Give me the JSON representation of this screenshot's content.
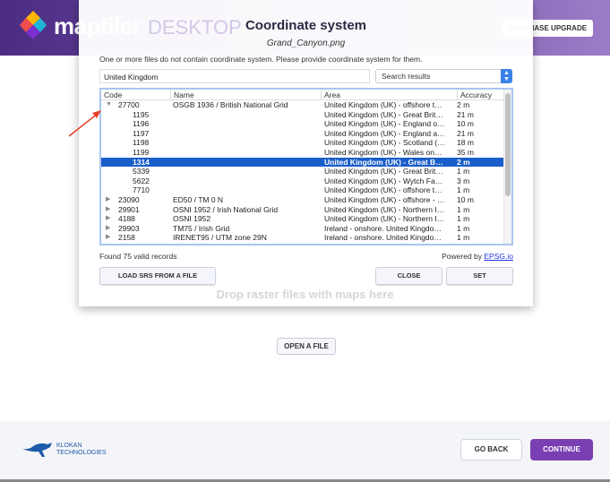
{
  "app": {
    "brand": "maptiler",
    "edition": "DESKTOP",
    "purchase_label": "PURCHASE UPGRADE",
    "drop_hint": "Drop raster files with maps here",
    "open_file_label": "OPEN A FILE"
  },
  "footer": {
    "company_line1": "KLOKAN",
    "company_line2": "TECHNOLOGIES",
    "go_back_label": "GO BACK",
    "continue_label": "CONTINUE",
    "accent": "#7a3fb2"
  },
  "dialog": {
    "title": "Coordinate system",
    "file": "Grand_Canyon.png",
    "message": "One or more files do not contain coordinate system. Please provide coordinate system for them.",
    "search_value": "United Kingdom",
    "filter_selected": "Search results",
    "columns": [
      "Code",
      "Name",
      "Area",
      "Accuracy"
    ],
    "rows": [
      {
        "toggle": "expanded",
        "code": "27700",
        "name": "OSGB 1936 / British National Grid",
        "area": "United Kingdom (UK) - offshore t…",
        "accuracy": "2 m"
      },
      {
        "child": true,
        "code": "1195",
        "name": "",
        "area": "United Kingdom (UK) - Great Brit…",
        "accuracy": "21 m"
      },
      {
        "child": true,
        "code": "1196",
        "name": "",
        "area": "United Kingdom (UK) - England o…",
        "accuracy": "10 m"
      },
      {
        "child": true,
        "code": "1197",
        "name": "",
        "area": "United Kingdom (UK) - England a…",
        "accuracy": "21 m"
      },
      {
        "child": true,
        "code": "1198",
        "name": "",
        "area": "United Kingdom (UK) - Scotland (…",
        "accuracy": "18 m"
      },
      {
        "child": true,
        "code": "1199",
        "name": "",
        "area": "United Kingdom (UK) - Wales on…",
        "accuracy": "35 m"
      },
      {
        "child": true,
        "selected": true,
        "code": "1314",
        "name": "",
        "area": "United Kingdom (UK) - Great B…",
        "accuracy": "2 m"
      },
      {
        "child": true,
        "code": "5339",
        "name": "",
        "area": "United Kingdom (UK) - Great Brit…",
        "accuracy": "1 m"
      },
      {
        "child": true,
        "code": "5622",
        "name": "",
        "area": "United Kingdom (UK) - Wytch Fa…",
        "accuracy": "3 m"
      },
      {
        "child": true,
        "code": "7710",
        "name": "",
        "area": "United Kingdom (UK) - offshore t…",
        "accuracy": "1 m"
      },
      {
        "toggle": "collapsed",
        "code": "23090",
        "name": "ED50 / TM 0 N",
        "area": "United Kingdom (UK) - offshore - …",
        "accuracy": "10 m"
      },
      {
        "toggle": "collapsed",
        "code": "29901",
        "name": "OSNI 1952 / Irish National Grid",
        "area": "United Kingdom (UK) - Northern I…",
        "accuracy": "1 m"
      },
      {
        "toggle": "collapsed",
        "code": "4188",
        "name": "OSNI 1952",
        "area": "United Kingdom (UK) - Northern I…",
        "accuracy": "1 m"
      },
      {
        "toggle": "collapsed",
        "code": "29903",
        "name": "TM75 / Irish Grid",
        "area": "Ireland - onshore. United Kingdo…",
        "accuracy": "1 m"
      },
      {
        "toggle": "collapsed",
        "code": "2158",
        "name": "IRENET95 / UTM zone 29N",
        "area": "Ireland - onshore. United Kingdo…",
        "accuracy": "1 m"
      }
    ],
    "found_text": "Found 75 valid records",
    "powered_by": "Powered by",
    "powered_link": "EPSG.io",
    "load_label": "LOAD SRS FROM A FILE",
    "close_label": "CLOSE",
    "set_label": "SET"
  }
}
